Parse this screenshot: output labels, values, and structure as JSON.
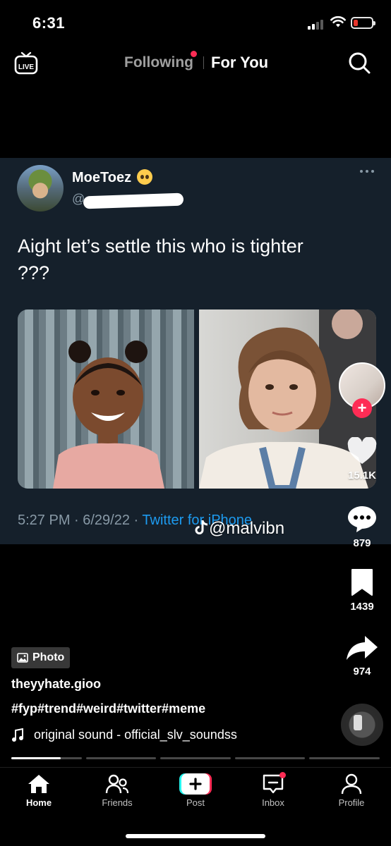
{
  "status_bar": {
    "time": "6:31",
    "battery_color": "#ff3b30"
  },
  "top_nav": {
    "live_label": "LIVE",
    "tabs": [
      {
        "label": "Following",
        "active": false,
        "has_notification_dot": true
      },
      {
        "label": "For You",
        "active": true
      }
    ],
    "accent": "#fe2c55"
  },
  "tweet": {
    "display_name": "MoeToez",
    "name_emoji": "pleading-face",
    "handle": "@",
    "text": "Aight let’s settle this who is tighter ???",
    "timestamp": "5:27 PM · 6/29/22 · ",
    "source": "Twitter for iPhone",
    "background": "#15202b",
    "link_color": "#1d9bf0"
  },
  "watermark": {
    "handle": "@malvibn"
  },
  "actions": {
    "likes": "15.1K",
    "comments": "879",
    "saves": "1439",
    "shares": "974"
  },
  "caption": {
    "badge": "Photo",
    "username": "theyyhate.gioo",
    "hashtags": "#fyp#trend#weird#twitter#meme",
    "sound": "original sound - official_slv_soundss"
  },
  "progress": {
    "segments": 5,
    "current": 1,
    "current_fill": 0.7
  },
  "tab_bar": {
    "tabs": [
      {
        "label": "Home",
        "active": true
      },
      {
        "label": "Friends"
      },
      {
        "label": "Post"
      },
      {
        "label": "Inbox",
        "has_notification_dot": true
      },
      {
        "label": "Profile"
      }
    ]
  }
}
